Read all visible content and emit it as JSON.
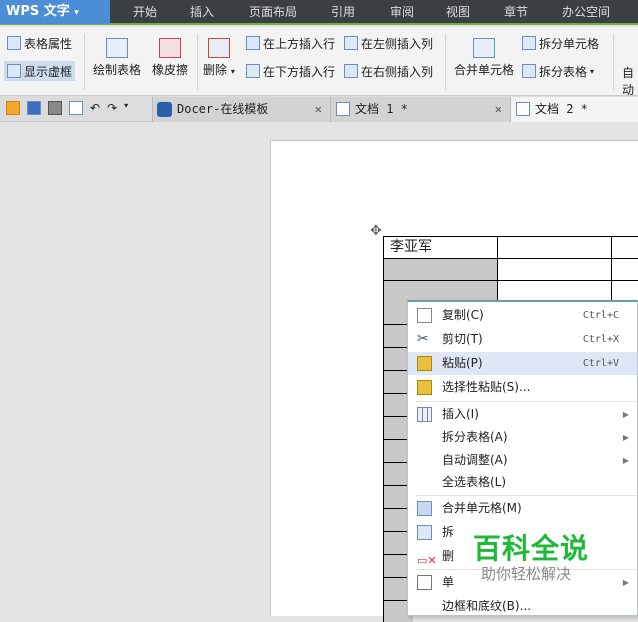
{
  "app": {
    "title": "WPS 文字"
  },
  "menu_tabs": [
    "开始",
    "插入",
    "页面布局",
    "引用",
    "审阅",
    "视图",
    "章节",
    "办公空间"
  ],
  "ribbon": {
    "table_props": "表格属性",
    "show_grid": "显示虚框",
    "draw_table": "绘制表格",
    "eraser": "橡皮擦",
    "delete": "删除",
    "insert_above": "在上方插入行",
    "insert_below": "在下方插入行",
    "insert_left": "在左侧插入列",
    "insert_right": "在右侧插入列",
    "merge": "合并单元格",
    "split_cell": "拆分单元格",
    "split_table": "拆分表格",
    "auto": "自动"
  },
  "doc_tabs": [
    {
      "label": "Docer-在线模板"
    },
    {
      "label": "文档 1 *"
    },
    {
      "label": "文档 2 *"
    }
  ],
  "table": {
    "cell_1": "李亚军"
  },
  "context_menu": {
    "items": [
      {
        "label": "复制(C)",
        "shortcut": "Ctrl+C"
      },
      {
        "label": "剪切(T)",
        "shortcut": "Ctrl+X"
      },
      {
        "label": "粘贴(P)",
        "shortcut": "Ctrl+V"
      },
      {
        "label": "选择性粘贴(S)..."
      },
      {
        "label": "插入(I)"
      },
      {
        "label": "拆分表格(A)"
      },
      {
        "label": "自动调整(A)"
      },
      {
        "label": "全选表格(L)"
      },
      {
        "label": "合并单元格(M)"
      },
      {
        "label": "拆"
      },
      {
        "label": "删"
      },
      {
        "label": "单"
      },
      {
        "label": "边框和底纹(B)..."
      }
    ]
  },
  "watermark": {
    "title": "百科全说",
    "subtitle": "助你轻松解决"
  }
}
